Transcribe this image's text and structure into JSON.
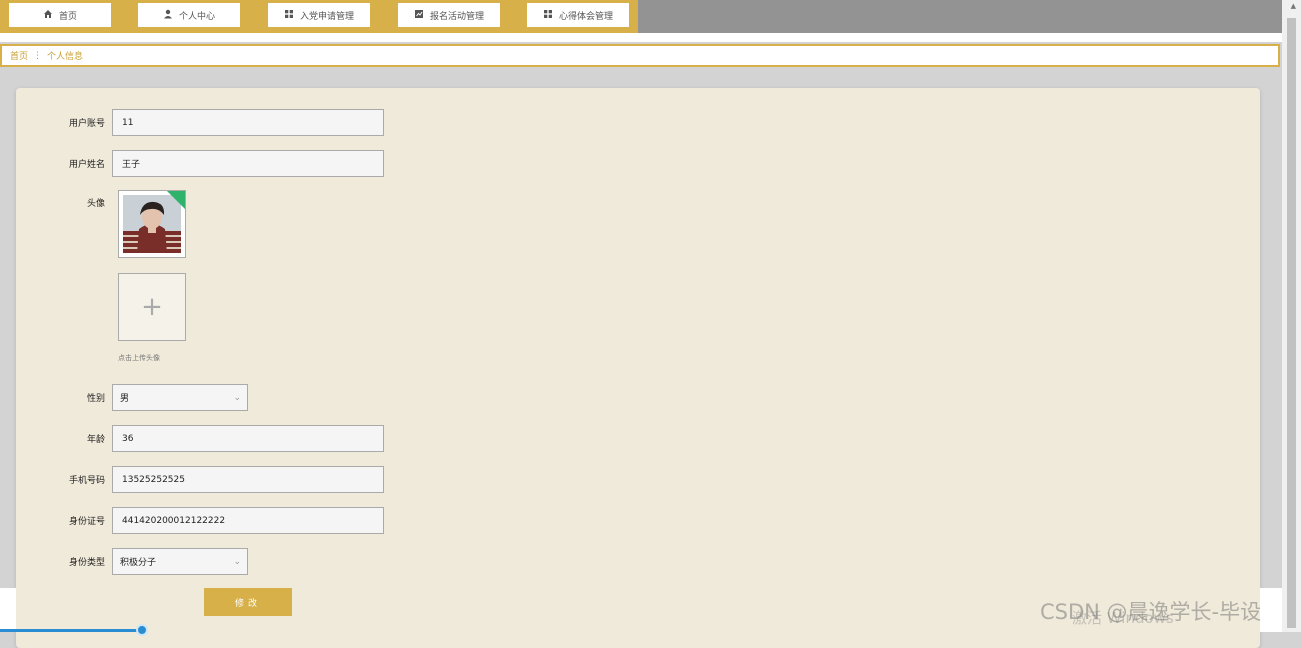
{
  "nav": {
    "items": [
      {
        "label": "首页",
        "icon": "home-icon"
      },
      {
        "label": "个人中心",
        "icon": "user-icon"
      },
      {
        "label": "入党申请管理",
        "icon": "grid-icon"
      },
      {
        "label": "报名活动管理",
        "icon": "chart-icon"
      },
      {
        "label": "心得体会管理",
        "icon": "grid-icon"
      }
    ]
  },
  "breadcrumb": {
    "home": "首页",
    "separator": "⋮",
    "current": "个人信息"
  },
  "form": {
    "account_label": "用户账号",
    "account_value": "11",
    "name_label": "用户姓名",
    "name_value": "王子",
    "avatar_label": "头像",
    "upload_hint": "点击上传头像",
    "gender_label": "性别",
    "gender_value": "男",
    "age_label": "年龄",
    "age_value": "36",
    "phone_label": "手机号码",
    "phone_value": "13525252525",
    "idcard_label": "身份证号",
    "idcard_value": "441420200012122222",
    "identity_label": "身份类型",
    "identity_value": "积极分子",
    "submit_label": "修改"
  },
  "watermark": "CSDN @晨逸学长-毕设",
  "os_overlay": "激活 Windows",
  "colors": {
    "accent": "#d7b04a",
    "card_bg": "#f0eada",
    "topbar_bg": "#939393"
  }
}
